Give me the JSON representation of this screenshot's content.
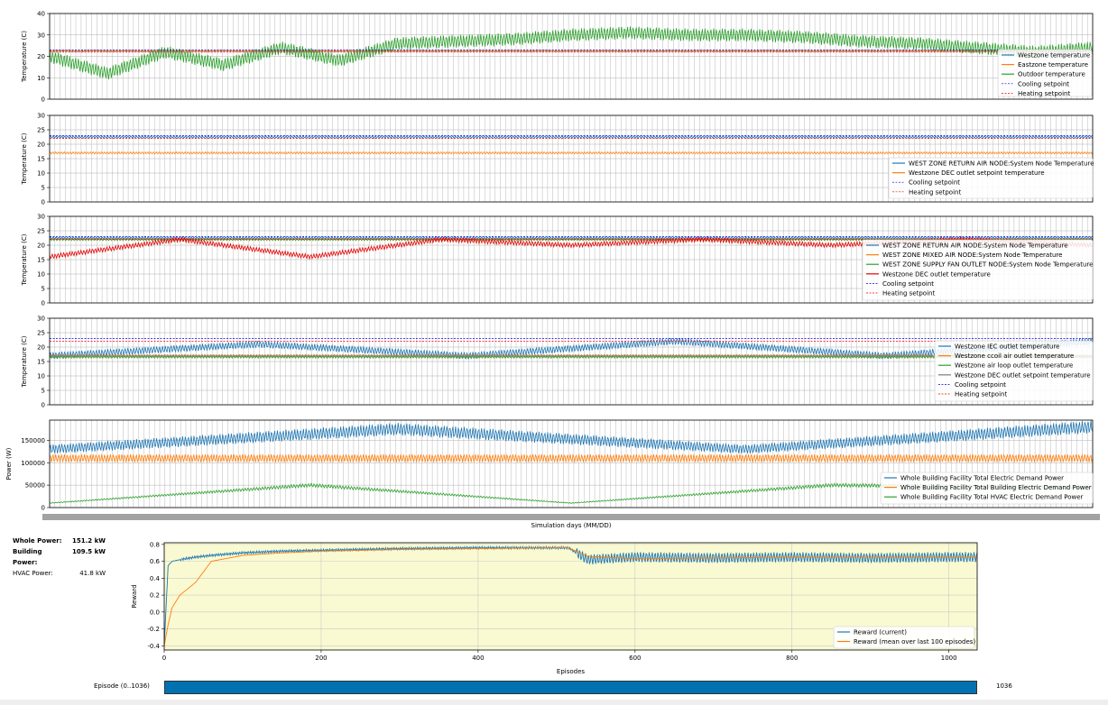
{
  "metrics": {
    "whole_label": "Whole Power:",
    "whole_value": "151.2 kW",
    "building_label": "Building Power:",
    "building_value": "109.5 kW",
    "hvac_label": "HVAC Power:",
    "hvac_value": "41.8 kW"
  },
  "episode": {
    "label": "Episode (0..1036)",
    "value": "1036",
    "progress": 1.0
  },
  "chart_data": [
    {
      "type": "line",
      "ylabel": "Temperature (C)",
      "ylim": [
        0,
        40
      ],
      "yticks": [
        0,
        10,
        20,
        30,
        40
      ],
      "grid": true,
      "legend_position": "right",
      "series": [
        {
          "name": "Westzone temperature",
          "color": "#1f77b4",
          "style": "solid",
          "values": [
            22.5,
            22.5,
            22.5
          ]
        },
        {
          "name": "Eastzone temperature",
          "color": "#ff7f0e",
          "style": "solid",
          "values": [
            22.5,
            22.5,
            22.5
          ]
        },
        {
          "name": "Outdoor temperature",
          "color": "#2ca02c",
          "style": "solid",
          "values": [
            20,
            12,
            22,
            16,
            24,
            18,
            26,
            27,
            28,
            30,
            31,
            30,
            30,
            29,
            27,
            26,
            24,
            22,
            24
          ]
        },
        {
          "name": "Cooling setpoint",
          "color": "#0000ff",
          "style": "dashed",
          "values": [
            23,
            23,
            23
          ]
        },
        {
          "name": "Heating setpoint",
          "color": "#ff0000",
          "style": "dashed",
          "values": [
            22,
            22,
            22
          ]
        }
      ]
    },
    {
      "type": "line",
      "ylabel": "Temperature (C)",
      "ylim": [
        0,
        30
      ],
      "yticks": [
        0,
        5,
        10,
        15,
        20,
        25,
        30
      ],
      "grid": true,
      "legend_position": "lower right",
      "series": [
        {
          "name": "WEST ZONE RETURN AIR NODE:System Node Temperature",
          "color": "#1f77b4",
          "style": "solid",
          "values": [
            22.5,
            22.5,
            22.5
          ]
        },
        {
          "name": "Westzone DEC outlet setpoint temperature",
          "color": "#ff7f0e",
          "style": "solid",
          "values": [
            17,
            17,
            17
          ]
        },
        {
          "name": "Cooling setpoint",
          "color": "#0000ff",
          "style": "dashed",
          "values": [
            23,
            23,
            23
          ]
        },
        {
          "name": "Heating setpoint",
          "color": "#ff0000",
          "style": "dashed",
          "values": [
            22,
            22,
            22
          ]
        }
      ]
    },
    {
      "type": "line",
      "ylabel": "Temperature (C)",
      "ylim": [
        0,
        30
      ],
      "yticks": [
        0,
        5,
        10,
        15,
        20,
        25,
        30
      ],
      "grid": true,
      "legend_position": "lower right",
      "series": [
        {
          "name": "WEST ZONE RETURN AIR NODE:System Node Temperature",
          "color": "#1f77b4",
          "style": "solid",
          "values": [
            22.5,
            22.5,
            22.5
          ]
        },
        {
          "name": "WEST ZONE MIXED AIR NODE:System Node Temperature",
          "color": "#ff7f0e",
          "style": "solid",
          "values": [
            22,
            22,
            22
          ]
        },
        {
          "name": "WEST ZONE SUPPLY FAN OUTLET NODE:System Node Temperature",
          "color": "#2ca02c",
          "style": "solid",
          "values": [
            22,
            22,
            22
          ]
        },
        {
          "name": "Westzone DEC outlet temperature",
          "color": "#e50000",
          "style": "solid",
          "values": [
            16,
            22,
            16,
            22,
            20,
            22,
            20,
            22,
            20
          ]
        },
        {
          "name": "Cooling setpoint",
          "color": "#0000ff",
          "style": "dashed",
          "values": [
            23,
            23,
            23
          ]
        },
        {
          "name": "Heating setpoint",
          "color": "#ff0000",
          "style": "dashed",
          "values": [
            22,
            22,
            22
          ]
        }
      ]
    },
    {
      "type": "line",
      "ylabel": "Temperature (C)",
      "ylim": [
        0,
        30
      ],
      "yticks": [
        0,
        5,
        10,
        15,
        20,
        25,
        30
      ],
      "grid": true,
      "legend_position": "lower right",
      "series": [
        {
          "name": "Westzone IEC outlet temperature",
          "color": "#1f77b4",
          "style": "solid",
          "values": [
            17,
            21,
            17,
            22,
            17,
            22
          ]
        },
        {
          "name": "Westzone ccoil air outlet temperature",
          "color": "#ff7f0e",
          "style": "solid",
          "values": [
            17,
            17,
            17
          ]
        },
        {
          "name": "Westzone air loop outlet temperature",
          "color": "#2ca02c",
          "style": "solid",
          "values": [
            16.5,
            16.5,
            16.5
          ]
        },
        {
          "name": "Westzone DEC outlet setpoint temperature",
          "color": "#7f7f7f",
          "style": "solid",
          "values": [
            17,
            17,
            17
          ]
        },
        {
          "name": "Cooling setpoint",
          "color": "#0000ff",
          "style": "dashed",
          "values": [
            23,
            23,
            23
          ]
        },
        {
          "name": "Heating setpoint",
          "color": "#ff0000",
          "style": "dashed",
          "values": [
            22,
            22,
            22
          ]
        }
      ]
    },
    {
      "type": "line",
      "ylabel": "Power (W)",
      "xlabel": "Simulation days (MM/DD)",
      "yticks": [
        0,
        50000,
        100000,
        150000
      ],
      "ylim": [
        0,
        195000
      ],
      "grid": true,
      "legend_position": "lower right",
      "series": [
        {
          "name": "Whole Building Facility Total Electric Demand Power",
          "color": "#1f77b4",
          "style": "solid",
          "values": [
            130000,
            175000,
            130000,
            180000
          ]
        },
        {
          "name": "Whole Building Facility Total Building Electric Demand Power",
          "color": "#ff7f0e",
          "style": "solid",
          "values": [
            110000,
            110000,
            110000
          ]
        },
        {
          "name": "Whole Building Facility Total HVAC Electric Demand Power",
          "color": "#2ca02c",
          "style": "solid",
          "values": [
            10000,
            50000,
            10000,
            50000,
            45000
          ]
        }
      ]
    },
    {
      "type": "line",
      "xlabel": "Episodes",
      "ylabel": "Reward",
      "xlim": [
        0,
        1036
      ],
      "ylim": [
        -0.45,
        0.82
      ],
      "xticks": [
        0,
        200,
        400,
        600,
        800,
        1000
      ],
      "yticks": [
        -0.4,
        -0.2,
        0.0,
        0.2,
        0.4,
        0.6,
        0.8
      ],
      "grid": true,
      "background": "#fafad2",
      "legend_position": "lower right",
      "x": [
        0,
        5,
        10,
        20,
        40,
        60,
        100,
        150,
        200,
        300,
        400,
        500,
        515,
        540,
        600,
        700,
        800,
        900,
        1000,
        1036
      ],
      "series": [
        {
          "name": "Reward (current)",
          "color": "#1f77b4",
          "values": [
            -0.4,
            0.55,
            0.6,
            0.62,
            0.65,
            0.67,
            0.7,
            0.72,
            0.73,
            0.75,
            0.76,
            0.76,
            0.76,
            0.62,
            0.65,
            0.64,
            0.65,
            0.64,
            0.65,
            0.65
          ]
        },
        {
          "name": "Reward (mean over last 100 episodes)",
          "color": "#ff7f0e",
          "values": [
            -0.4,
            -0.15,
            0.05,
            0.2,
            0.35,
            0.6,
            0.67,
            0.7,
            0.72,
            0.74,
            0.75,
            0.76,
            0.76,
            0.66,
            0.63,
            0.64,
            0.65,
            0.65,
            0.65,
            0.65
          ]
        }
      ]
    }
  ]
}
